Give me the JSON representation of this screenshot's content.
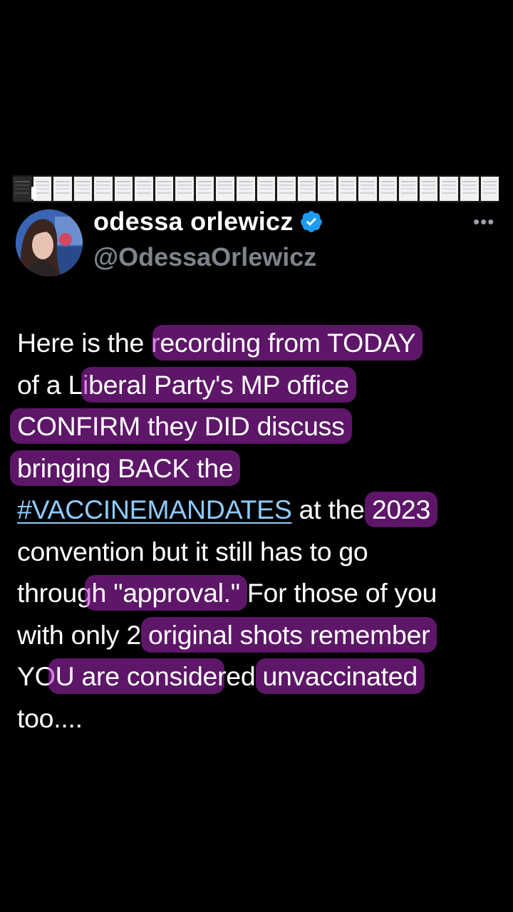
{
  "colors": {
    "background": "#000000",
    "text": "#ffffff",
    "handle": "#7d848c",
    "highlight": "#aa28be",
    "hashtag": "#8ecbff",
    "verified": "#1d9bf0"
  },
  "header": {
    "display_name": "odessa orlewicz",
    "handle": "@OdessaOrlewicz",
    "verified_icon": "verified-badge-icon",
    "more_icon": "•••"
  },
  "tweet": {
    "lines": [
      {
        "a": "Here is the r",
        "hl": "ecording from TODAY",
        "b": ""
      },
      {
        "a": "of a Li",
        "hl": "beral Party's MP office",
        "b": ""
      },
      {
        "a": "",
        "hl": "CONFIRM they DID discuss",
        "b": ""
      },
      {
        "a": "",
        "hl": "bringing BACK the",
        "b": ""
      },
      {
        "hashtag": "#VACCINEMANDATES",
        "a": " at the ",
        "hl": "2023",
        "b": ""
      },
      {
        "a": "convention but it still has to go",
        "hl": "",
        "b": ""
      },
      {
        "a": "throug",
        "hl": "h \"approval.\"",
        "b": " For those of you"
      },
      {
        "a": "with only 2 ",
        "hl": "original shots remember",
        "b": ""
      },
      {
        "a": "YO",
        "hl": "U are conside",
        "b": "red ",
        "hl2": "unvaccinated"
      },
      {
        "a": "too....",
        "hl": "",
        "b": ""
      }
    ]
  }
}
